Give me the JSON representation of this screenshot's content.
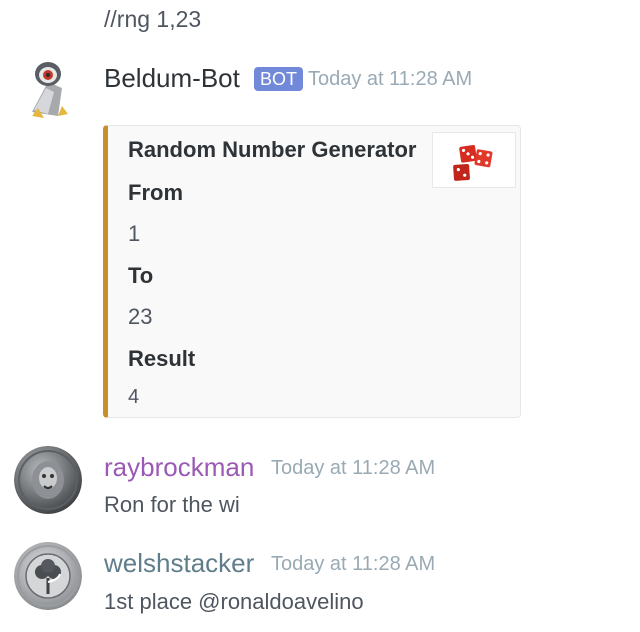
{
  "command_message": {
    "text": "//rng 1,23"
  },
  "bot_message": {
    "username": "Beldum-Bot",
    "badge": "BOT",
    "timestamp": "Today at 11:28 AM",
    "avatar_icon": "beldum-avatar",
    "embed": {
      "accent_color": "#c8902c",
      "title": "Random Number Generator",
      "thumbnail_icon": "dice-icon",
      "fields": [
        {
          "name": "From",
          "value": "1"
        },
        {
          "name": "To",
          "value": "23"
        },
        {
          "name": "Result",
          "value": "4"
        }
      ]
    }
  },
  "messages": [
    {
      "username": "raybrockman",
      "username_color": "#9b59b6",
      "timestamp": "Today at 11:28 AM",
      "text": "Ron for the wi",
      "avatar_icon": "lion-coin-avatar"
    },
    {
      "username": "welshstacker",
      "username_color": "#607d8b",
      "timestamp": "Today at 11:28 AM",
      "text": "1st place @ronaldoavelino",
      "avatar_icon": "tree-coin-avatar"
    }
  ],
  "colors": {
    "bot_badge": "#7289da",
    "timestamp": "#99aab5",
    "bot_username": "#2e3338"
  }
}
